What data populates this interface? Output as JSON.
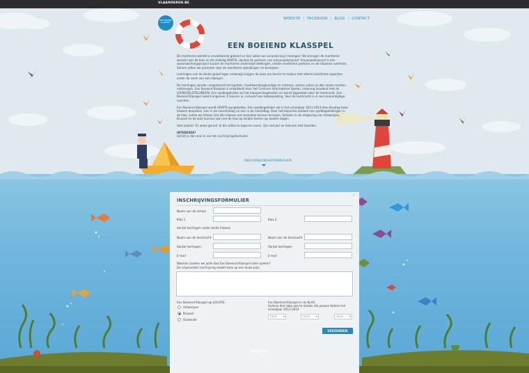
{
  "topbar": {
    "brand": "VLAANDEREN.BE"
  },
  "logo": {
    "text": "EEN BOEIEND KLASSPEL"
  },
  "nav": {
    "website": "WEBSITE",
    "facebook": "FACEBOOK",
    "blog": "BLOG",
    "contact": "CONTACT"
  },
  "page": {
    "title": "EEN BOEIEND KLASSPEL"
  },
  "intro": {
    "p1": "De maritieme wereld is onvoldoende gekend en hier willen we verandering in brengen! We brengen de maritieme wereld naar de klas en dit volledig GRATIS, dankzij de partners van amyouwaterproof. Amyouwaterproof is een samenwerkingsproject tussen de maritieme onderwijsinstellingen, enkele maritieme partners en de Vlaamse overheid. Samen willen we promotie voor de maritieme opleidingen en beroepen.",
    "p2": "Leerlingen van de derde graad lager onderwijs krijgen de kans om kennis te maken met allerlei maritieme aspecten onder de vorm van een klasspel.",
    "p3": "De leerlingen worden omgetoverd tot kapitein, hoofdwerktuigkundige en matroos, samen zullen ze alle reizen moeten volbrengen. Een Boeiend Klasspel is ontwikkeld door het Centrum Informatieve Spelen, rekening houdend met de LEERDOELSTELLINGEN. Een spelbegeleider zal het klasspel begeleiden en wordt bijgestaan door de leerkracht. Een Boeiend Klasspel neemt ongeveer 2 lesuren in, inclusief een kabespreking. Voor de leerkracht is er een lerarenbijlage voorzien.",
    "p4": "Een Boeiend Klasspel wordt GRATIS aangeboden. Een spelbegeleider zal in het schooljaar 2013-2014 elke dinsdag twee klassen bezoeken, een in de voormiddag en een in de namiddag. Door het beperkte aanbod van spelbegeleidingen in de klas, zullen we helaas niet alle klassen een bezoekje kunnen brengen. Scholen in de omgeving van Antwerpen, Brussel en de kust kunnen ook met de klas op locatie komen op andere dagen.",
    "p5": "Veel plezier! En wees gerust: al die willen te kaperen varen, zijn niet per se mannen met baarden.",
    "interest_head": "INTERESSE?",
    "interest_text": "Schrijf je dan snel in via het inschrijvingsformulier."
  },
  "cta": {
    "label": "INSCHRIJVINGSFORMULIER"
  },
  "form": {
    "title": "INSCHRIJVINGSFORMULIER",
    "close": "×",
    "school_label": "Naam van de school",
    "klas1_label": "Klas 1",
    "klas2_label": "Klas 2",
    "aantal_beide": "Aantal leerlingen onder beide klassen",
    "leerkracht1_label": "Naam van de leerkracht",
    "leerkracht2_label": "Naam van de leerkracht",
    "aantal1_label": "Aantal leerlingen",
    "aantal2_label": "Aantal leerlingen",
    "email1_label": "E-mail",
    "email2_label": "E-mail",
    "why_q1": "Waarom zouden we jullie klas Een Boeiend Klasspel laten spelen?",
    "why_q2": "De origineelste inschrijving maakt kans op een leuke prijs.",
    "locatie_label": "Een Boeiend Klasspel op LOCATIE:",
    "locatie_options": [
      "Antwerpen",
      "Brussel",
      "Oostende"
    ],
    "locatie_selected": "Brussel",
    "klas_label1": "Een Boeiend Klasspel in de KLAS:",
    "klas_label2": "Gelieve drie data aan te duiden die passen tijdens het schooljaar 2013-2014",
    "date1": "DD/M",
    "date2": "DD/M",
    "date3": "DD/M",
    "submit": "VERZENDEN"
  },
  "footer": {
    "label": "INLEIDING"
  },
  "colors": {
    "accent": "#1f8cc8",
    "title": "#2c5563",
    "sea": "#6fb6dd",
    "sky": "#dfe9ee"
  }
}
